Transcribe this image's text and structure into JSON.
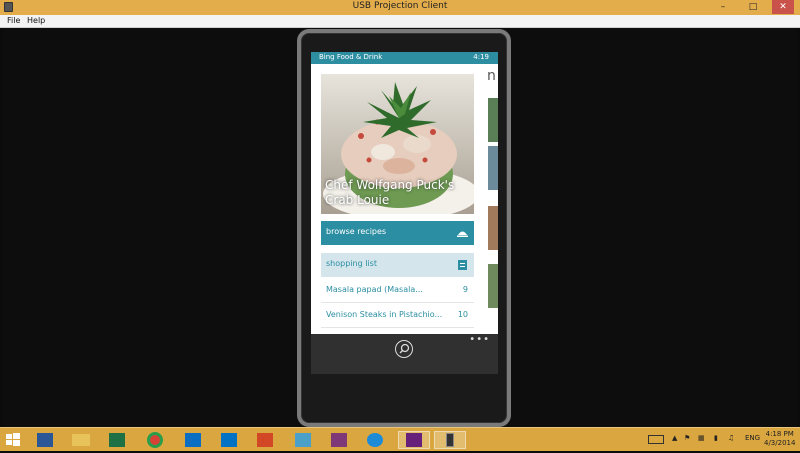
{
  "window": {
    "title": "USB Projection Client",
    "minimize": "–",
    "maximize": "□",
    "close": "✕"
  },
  "menu": {
    "file": "File",
    "help": "Help"
  },
  "phone": {
    "status": {
      "app": "Bing Food & Drink",
      "time": "4:19"
    },
    "hero_title_line1": "Chef Wolfgang Puck's",
    "hero_title_line2": "Crab Louie",
    "peek_letter": "n",
    "browse_label": "browse recipes",
    "shopping_label": "shopping list",
    "list": [
      {
        "label": "Masala papad  (Masala...",
        "count": "9"
      },
      {
        "label": "Venison Steaks in Pistachio...",
        "count": "10"
      }
    ],
    "appbar_more": "•••"
  },
  "taskbar": {
    "tray_lang": "ENG",
    "clock_time": "4:18 PM",
    "clock_date": "4/3/2014"
  },
  "colors": {
    "accent": "#2b8ea2",
    "taskbar": "#d9a63f",
    "titlebar": "#e4ad4c"
  }
}
